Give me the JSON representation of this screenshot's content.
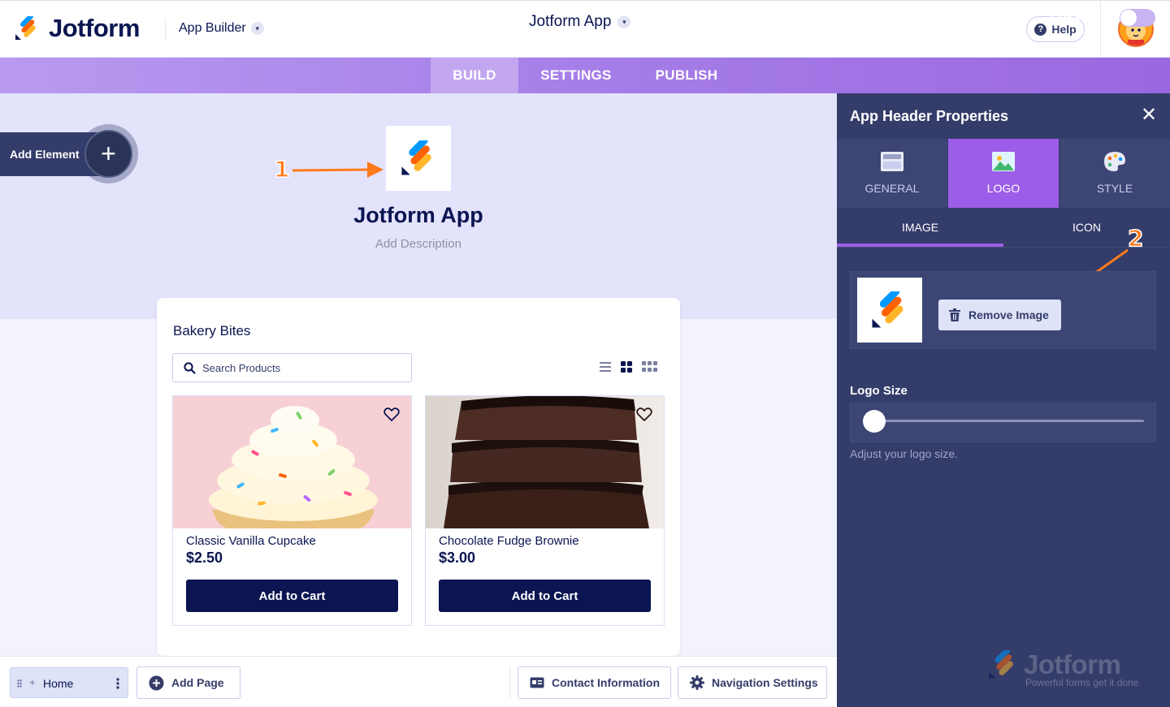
{
  "header": {
    "brand": "Jotform",
    "builder_label": "App Builder",
    "app_title": "Jotform App",
    "help_label": "Help"
  },
  "nav": {
    "tabs": [
      {
        "label": "BUILD",
        "active": true
      },
      {
        "label": "SETTINGS",
        "active": false
      },
      {
        "label": "PUBLISH",
        "active": false
      }
    ],
    "live_preview_label": "Live Preview",
    "live_preview_on": false
  },
  "canvas": {
    "add_element_label": "Add Element",
    "app_name": "Jotform App",
    "app_description_placeholder": "Add Description",
    "store": {
      "title": "Bakery Bites",
      "search_placeholder": "Search Products",
      "products": [
        {
          "name": "Classic Vanilla Cupcake",
          "price": "$2.50",
          "cta": "Add to Cart"
        },
        {
          "name": "Chocolate Fudge Brownie",
          "price": "$3.00",
          "cta": "Add to Cart"
        }
      ]
    }
  },
  "annotations": {
    "first": "1",
    "second": "2"
  },
  "bottom_bar": {
    "page_label": "Home",
    "add_page_label": "Add Page",
    "contact_label": "Contact Information",
    "nav_settings_label": "Navigation Settings"
  },
  "panel": {
    "title": "App Header Properties",
    "tabs": [
      {
        "label": "GENERAL",
        "icon": "layout-icon"
      },
      {
        "label": "LOGO",
        "icon": "image-icon",
        "active": true
      },
      {
        "label": "STYLE",
        "icon": "palette-icon"
      }
    ],
    "subtabs": [
      {
        "label": "IMAGE",
        "active": true
      },
      {
        "label": "ICON",
        "active": false
      }
    ],
    "remove_image_label": "Remove Image",
    "logo_size_label": "Logo Size",
    "logo_size_value": 0,
    "logo_size_hint": "Adjust your logo size.",
    "watermark_brand": "Jotform",
    "watermark_tagline": "Powerful forms get it done"
  },
  "colors": {
    "navy": "#0a1551",
    "accent_purple": "#9c5ee8",
    "panel_bg": "#343c6a",
    "annotation_orange": "#ff7a1a"
  }
}
